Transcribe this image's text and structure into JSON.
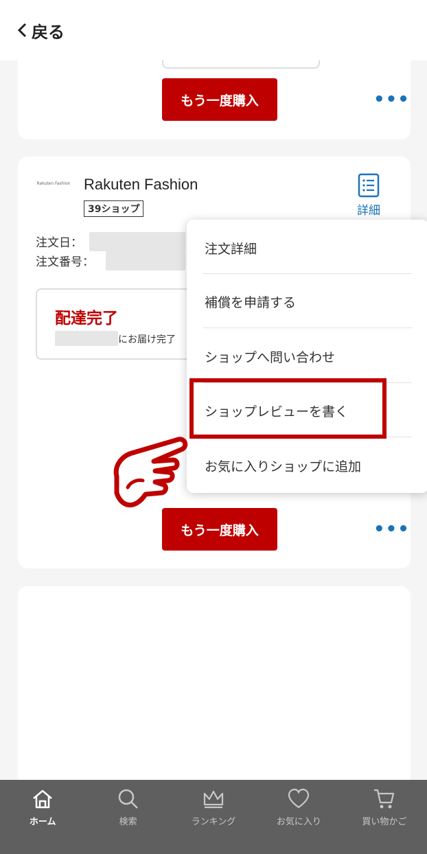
{
  "header": {
    "back_label": "戻る"
  },
  "prev_order": {
    "rebuy_label": "もう一度購入",
    "more_label": "•••"
  },
  "order": {
    "shop_logo_text": "Rakuten Fashion",
    "shop_name": "Rakuten Fashion",
    "shop_badge": "39ショップ",
    "detail_label": "詳細",
    "order_date_label": "注文日：",
    "order_number_label": "注文番号：",
    "status_title": "配達完了",
    "status_sub": "にお届け完了",
    "rebuy_label": "もう一度購入",
    "more_label": "•••"
  },
  "menu": {
    "items": [
      {
        "label": "注文詳細"
      },
      {
        "label": "補償を申請する"
      },
      {
        "label": "ショップへ問い合わせ"
      },
      {
        "label": "ショップレビューを書く"
      },
      {
        "label": "お気に入りショップに追加"
      }
    ],
    "highlighted_index": 3
  },
  "tabbar": {
    "tabs": [
      {
        "label": "ホーム",
        "icon": "home-icon",
        "active": true
      },
      {
        "label": "検索",
        "icon": "search-icon",
        "active": false
      },
      {
        "label": "ランキング",
        "icon": "crown-icon",
        "active": false
      },
      {
        "label": "お気に入り",
        "icon": "heart-icon",
        "active": false
      },
      {
        "label": "買い物かご",
        "icon": "cart-icon",
        "active": false
      }
    ]
  },
  "colors": {
    "accent": "#bf0000",
    "link": "#1a73b8",
    "tabbar_bg": "#5f5f5f"
  }
}
